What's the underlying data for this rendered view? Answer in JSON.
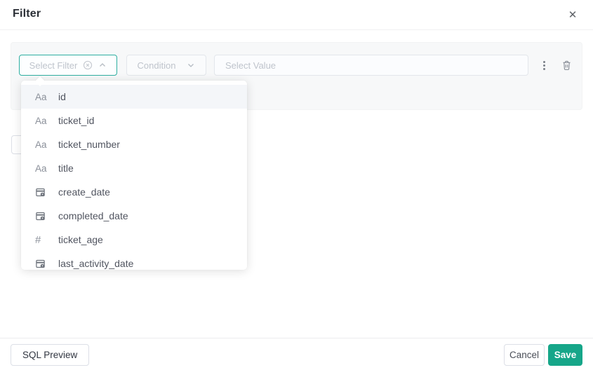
{
  "dialog": {
    "title": "Filter",
    "close_icon": "✕"
  },
  "filter_row": {
    "field_select": {
      "placeholder": "Select Filter",
      "state": "open",
      "clear_icon": "circle-x",
      "chevron": "up"
    },
    "condition_select": {
      "placeholder": "Condition",
      "chevron": "down"
    },
    "value_input": {
      "placeholder": "Select Value",
      "value": ""
    },
    "more_icon": "kebab-vertical",
    "delete_icon": "trash"
  },
  "dropdown": {
    "type_icons": {
      "text": "Aa",
      "number": "#",
      "date": "calendar-icon"
    },
    "items": [
      {
        "type": "text",
        "label": "id",
        "selected": true
      },
      {
        "type": "text",
        "label": "ticket_id"
      },
      {
        "type": "text",
        "label": "ticket_number"
      },
      {
        "type": "text",
        "label": "title"
      },
      {
        "type": "date",
        "label": "create_date"
      },
      {
        "type": "date",
        "label": "completed_date"
      },
      {
        "type": "number",
        "label": "ticket_age"
      },
      {
        "type": "date",
        "label": "last_activity_date"
      }
    ]
  },
  "footer": {
    "sql_preview_label": "SQL Preview",
    "cancel_label": "Cancel",
    "save_label": "Save"
  },
  "colors": {
    "accent_teal": "#16a689",
    "active_border": "#2eafa1",
    "panel_bg": "#f7f8f9",
    "placeholder": "#bfc4cc",
    "item_text": "#515560",
    "icon_gray": "#8b909a"
  }
}
